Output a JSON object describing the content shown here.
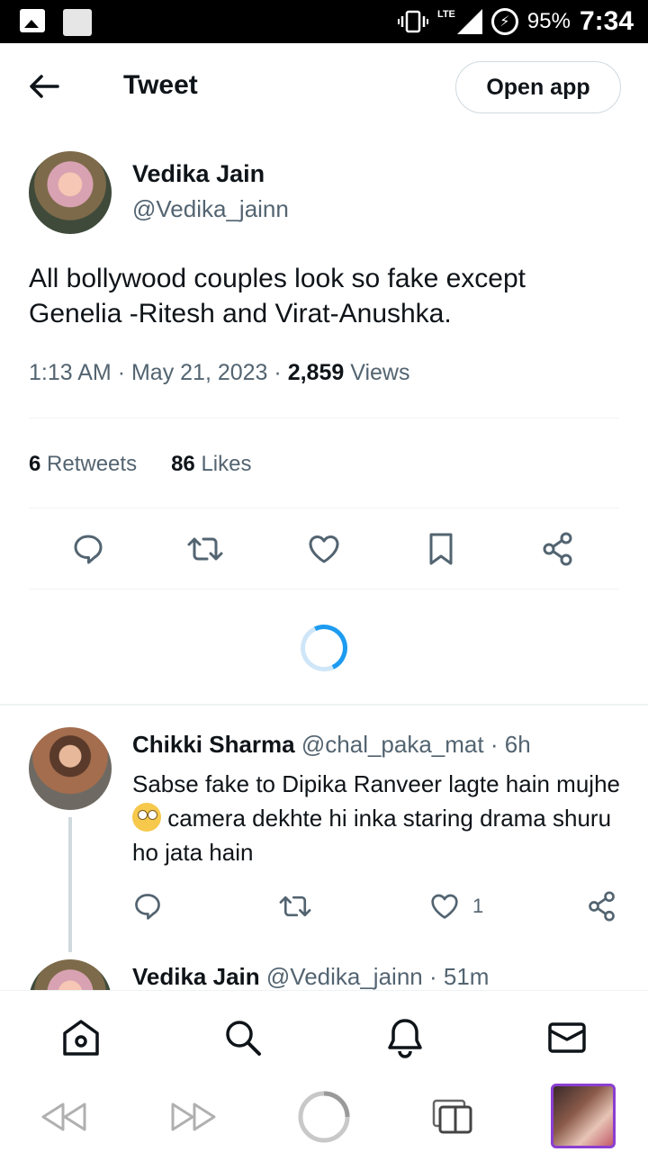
{
  "status_bar": {
    "lte": "LTE",
    "battery": "95%",
    "time": "7:34"
  },
  "header": {
    "title": "Tweet",
    "open_app": "Open app"
  },
  "tweet": {
    "author_name": "Vedika Jain",
    "author_handle": "@Vedika_jainn",
    "text": "All bollywood couples look so fake except Genelia -Ritesh and Virat-Anushka.",
    "time": "1:13 AM",
    "date": "May 21, 2023",
    "views_count": "2,859",
    "views_label": "Views",
    "retweets_count": "6",
    "retweets_label": "Retweets",
    "likes_count": "86",
    "likes_label": "Likes"
  },
  "replies": [
    {
      "name": "Chikki Sharma",
      "handle": "@chal_paka_mat",
      "age": "6h",
      "text_before_emoji": "Sabse fake to Dipika Ranveer lagte hain mujhe",
      "emoji": "eye-roll-emoji",
      "text_after_emoji": " camera dekhte hi inka staring drama shuru ho jata hain",
      "likes": "1"
    },
    {
      "name": "Vedika Jain",
      "handle": "@Vedika_jainn",
      "age": "51m"
    }
  ],
  "colors": {
    "text": "#0f1419",
    "secondary": "#536471",
    "accent": "#1d9bf0",
    "divider": "#eff3f4"
  },
  "bottom_nav": [
    "home-icon",
    "search-icon",
    "notifications-icon",
    "messages-icon"
  ],
  "browser_bar": [
    "rewind-icon",
    "fast-forward-icon",
    "reload-icon",
    "tabs-icon",
    "tab-thumbnail"
  ]
}
